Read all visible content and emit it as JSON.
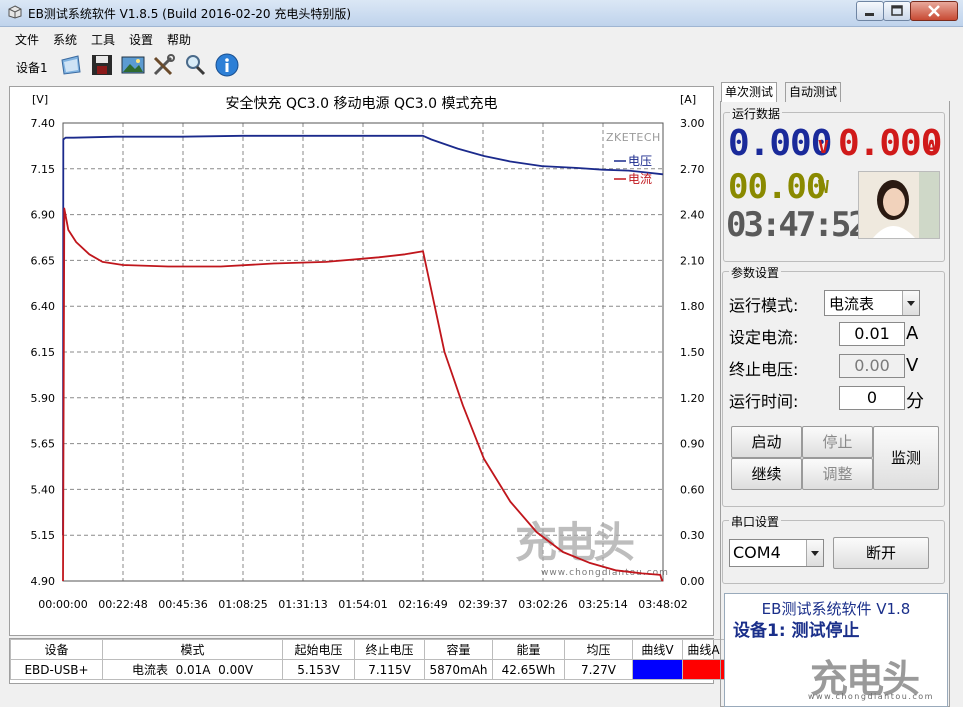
{
  "window": {
    "title": "EB测试系统软件 V1.8.5 (Build 2016-02-20 充电头特别版)"
  },
  "menu": [
    "文件",
    "系统",
    "工具",
    "设置",
    "帮助"
  ],
  "toolbar": {
    "device_label": "设备1",
    "buttons": [
      "folder-icon",
      "save-icon",
      "image-icon",
      "tools-icon",
      "search-icon",
      "info-icon"
    ]
  },
  "chart_data": {
    "type": "line",
    "title": "安全快充 QC3.0 移动电源 QC3.0 模式充电",
    "left_unit": "[V]",
    "right_unit": "[A]",
    "brand": "ZKETECH",
    "y_left_ticks": [
      "7.40",
      "7.15",
      "6.90",
      "6.65",
      "6.40",
      "6.15",
      "5.90",
      "5.65",
      "5.40",
      "5.15",
      "4.90"
    ],
    "y_right_ticks": [
      "3.00",
      "2.70",
      "2.40",
      "2.10",
      "1.80",
      "1.50",
      "1.20",
      "0.90",
      "0.60",
      "0.30",
      "0.00"
    ],
    "x_ticks": [
      "00:00:00",
      "00:22:48",
      "00:45:36",
      "01:08:25",
      "01:31:13",
      "01:54:01",
      "02:16:49",
      "02:39:37",
      "03:02:26",
      "03:25:14",
      "03:48:02"
    ],
    "ylim_left": [
      4.9,
      7.4
    ],
    "ylim_right": [
      0.0,
      3.0
    ],
    "xlim_minutes": [
      0,
      228.03
    ],
    "series": [
      {
        "name": "电压",
        "color": "#1b2a8c",
        "axis": "left",
        "x_minutes": [
          0,
          0.1,
          1,
          4,
          20,
          45,
          68,
          91,
          114,
          136.8,
          140,
          150,
          160,
          170,
          182,
          195,
          205,
          215,
          228
        ],
        "values": [
          5.15,
          7.31,
          7.32,
          7.32,
          7.325,
          7.325,
          7.33,
          7.33,
          7.33,
          7.33,
          7.31,
          7.26,
          7.22,
          7.19,
          7.165,
          7.155,
          7.145,
          7.14,
          7.12
        ]
      },
      {
        "name": "电流",
        "color": "#c0161c",
        "axis": "right",
        "x_minutes": [
          0,
          0.5,
          2,
          5,
          10,
          15,
          22.8,
          40,
          60,
          80,
          100,
          120,
          130,
          136.8,
          145,
          152,
          160,
          170,
          180,
          190,
          200,
          210,
          220,
          227,
          227.5,
          228
        ],
        "values": [
          0.0,
          2.44,
          2.3,
          2.22,
          2.14,
          2.09,
          2.07,
          2.06,
          2.06,
          2.08,
          2.09,
          2.12,
          2.14,
          2.16,
          1.5,
          1.15,
          0.8,
          0.52,
          0.32,
          0.19,
          0.12,
          0.07,
          0.05,
          0.04,
          0.01,
          0.0
        ]
      }
    ],
    "grid": true,
    "legend": "top-right"
  },
  "summary_table": {
    "headers": [
      "设备",
      "模式",
      "起始电压",
      "终止电压",
      "容量",
      "能量",
      "均压",
      "曲线V",
      "曲线A"
    ],
    "row": [
      "EBD-USB+",
      "电流表  0.01A  0.00V",
      "5.153V",
      "7.115V",
      "5870mAh",
      "42.65Wh",
      "7.27V",
      "",
      ""
    ],
    "curve_colors": [
      "#0000ff",
      "#ff0000"
    ]
  },
  "tabs": [
    "单次测试",
    "自动测试"
  ],
  "run_data": {
    "title": "运行数据",
    "voltage": "0.000",
    "voltage_unit": "V",
    "current": "0.000",
    "current_unit": "A",
    "power": "00.00",
    "power_unit": "W",
    "time": "03:47:52",
    "colors": {
      "voltage": "#1a2a9a",
      "current": "#d01a1a",
      "power": "#8a8a00",
      "time": "#555555"
    }
  },
  "params": {
    "title": "参数设置",
    "mode_label": "运行模式:",
    "mode_value": "电流表",
    "current_label": "设定电流:",
    "current_value": "0.01",
    "current_unit": "A",
    "cutoff_label": "终止电压:",
    "cutoff_value": "0.00",
    "cutoff_unit": "V",
    "time_label": "运行时间:",
    "time_value": "0",
    "time_unit": "分",
    "buttons": {
      "start": "启动",
      "stop": "停止",
      "continue": "继续",
      "adjust": "调整",
      "monitor": "监测"
    }
  },
  "serial": {
    "title": "串口设置",
    "port": "COM4",
    "disconnect": "断开"
  },
  "status": {
    "line1": "EB测试系统软件 V1.8",
    "line2": "设备1: 测试停止"
  },
  "watermark": {
    "chart_text": "充电头",
    "chart_url": "www.chongdiantou.com",
    "corner_text": "充电头",
    "corner_url": "www.chongdiantou.com"
  }
}
